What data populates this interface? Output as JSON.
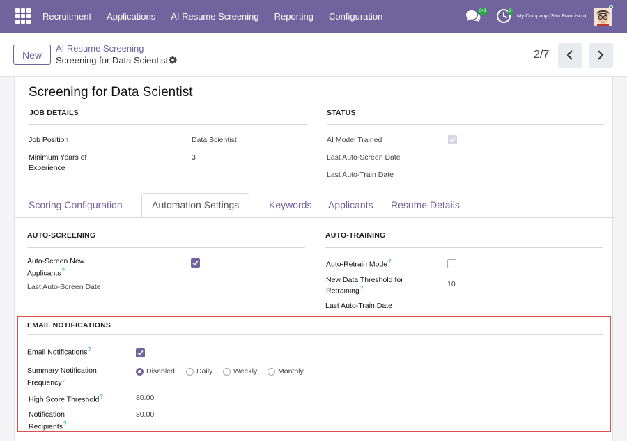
{
  "navbar": {
    "menu": [
      "Recruitment",
      "Applications",
      "AI Resume Screening",
      "Reporting",
      "Configuration"
    ],
    "chat_badge": "341",
    "activity_badge": "2",
    "company": "My Company (San Francisco)"
  },
  "control": {
    "new_label": "New",
    "breadcrumb_parent": "AI Resume Screening",
    "breadcrumb_current": "Screening for Data Scientist",
    "pager": "2/7"
  },
  "record": {
    "title": "Screening for Data Scientist",
    "job_details": {
      "heading": "JOB DETAILS",
      "job_position_label": "Job Position",
      "job_position_value": "Data Scientist",
      "min_years_label_1": "Minimum Years of",
      "min_years_label_2": "Experience",
      "min_years_value": "3"
    },
    "status": {
      "heading": "STATUS",
      "ai_model_trained_label": "AI Model Trained",
      "ai_model_trained": true,
      "last_auto_screen_label": "Last Auto-Screen Date",
      "last_auto_train_label": "Last Auto-Train Date"
    }
  },
  "tabs": [
    "Scoring Configuration",
    "Automation Settings",
    "Keywords",
    "Applicants",
    "Resume Details"
  ],
  "active_tab": "Automation Settings",
  "auto_screening": {
    "heading": "AUTO-SCREENING",
    "auto_screen_label_1": "Auto-Screen New",
    "auto_screen_label_2": "Applicants",
    "auto_screen_checked": true,
    "last_date_label": "Last Auto-Screen Date"
  },
  "auto_training": {
    "heading": "AUTO-TRAINING",
    "retrain_mode_label": "Auto-Retrain Mode",
    "retrain_mode_checked": false,
    "threshold_label_1": "New Data Threshold for",
    "threshold_label_2": "Retraining",
    "threshold_value": "10",
    "last_train_label": "Last Auto-Train Date"
  },
  "email": {
    "heading": "EMAIL NOTIFICATIONS",
    "notifications_label": "Email Notifications",
    "notifications_checked": true,
    "frequency_label_1": "Summary Notification",
    "frequency_label_2": "Frequency",
    "frequency_options": [
      "Disabled",
      "Daily",
      "Weekly",
      "Monthly"
    ],
    "frequency_selected": "Disabled",
    "high_score_label": "High Score Threshold",
    "high_score_value": "80.00",
    "recipients_label_1": "Notification",
    "recipients_label_2": "Recipients",
    "recipients_value": "80.00"
  },
  "colors": {
    "brand": "#71639e",
    "highlight": "#d9534f",
    "help": "#1ba1c5"
  },
  "icons": {
    "apps": "apps-grid-icon",
    "chat": "chat-icon",
    "activity": "clock-icon",
    "gear": "gear-icon",
    "prev": "chevron-left-icon",
    "next": "chevron-right-icon"
  }
}
